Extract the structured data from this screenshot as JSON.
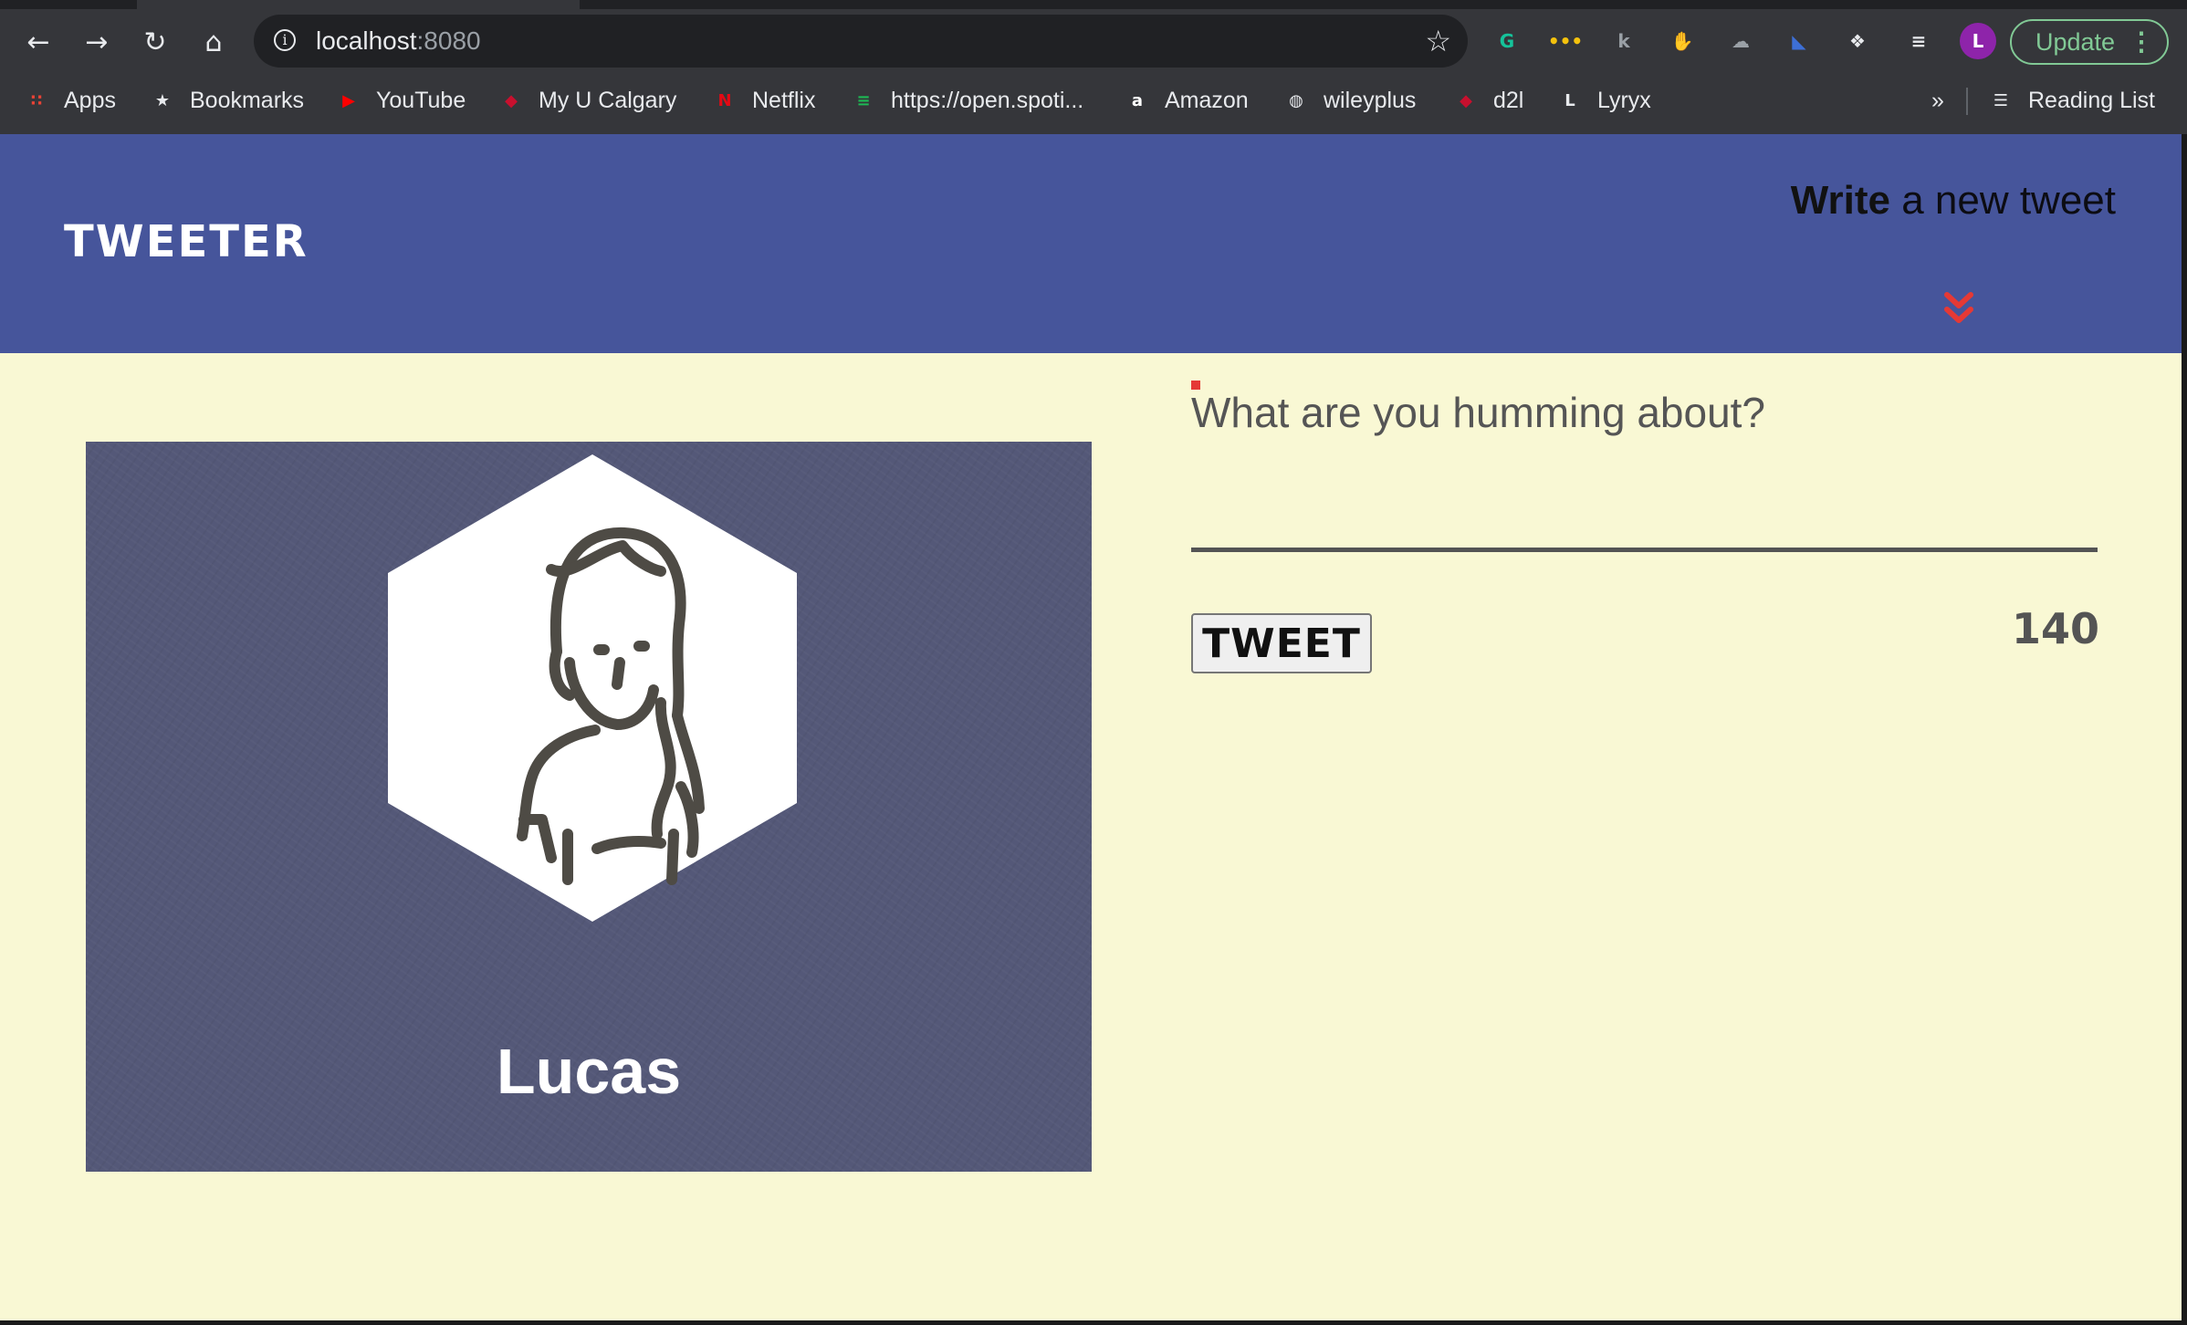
{
  "browser": {
    "address": {
      "host": "localhost",
      "port": ":8080"
    },
    "extensions": [
      {
        "name": "grammarly-icon",
        "glyph": "G",
        "color": "#15c39a"
      },
      {
        "name": "extension-yellow-icon",
        "glyph": "•••",
        "color": "#f4c20d"
      },
      {
        "name": "extension-k-icon",
        "glyph": "k",
        "color": "#9aa0a6"
      },
      {
        "name": "stop-hand-icon",
        "glyph": "✋",
        "color": "#e53935"
      },
      {
        "name": "extension-cloud-icon",
        "glyph": "☁",
        "color": "#9aa0a6"
      },
      {
        "name": "extension-shield-icon",
        "glyph": "◣",
        "color": "#3d6fd6"
      },
      {
        "name": "puzzle-icon",
        "glyph": "❖",
        "color": "#e8eaed"
      },
      {
        "name": "media-queue-icon",
        "glyph": "≡",
        "color": "#e8eaed"
      }
    ],
    "profile_initial": "L",
    "update_label": "Update",
    "bookmarks": [
      {
        "label": "Apps",
        "icon": "apps-grid-icon",
        "icon_color": "#ea4335",
        "glyph": "∷"
      },
      {
        "label": "Bookmarks",
        "icon": "star-icon",
        "icon_color": "#e8eaed",
        "glyph": "★"
      },
      {
        "label": "YouTube",
        "icon": "youtube-icon",
        "icon_color": "#ff0000",
        "glyph": "▶"
      },
      {
        "label": "My U Calgary",
        "icon": "ucalgary-crest-icon",
        "icon_color": "#c8102e",
        "glyph": "◆"
      },
      {
        "label": "Netflix",
        "icon": "netflix-icon",
        "icon_color": "#e50914",
        "glyph": "N"
      },
      {
        "label": "https://open.spoti...",
        "icon": "spotify-icon",
        "icon_color": "#1db954",
        "glyph": "≡"
      },
      {
        "label": "Amazon",
        "icon": "amazon-icon",
        "icon_color": "#ffffff",
        "glyph": "a"
      },
      {
        "label": "wileyplus",
        "icon": "globe-icon",
        "icon_color": "#e8eaed",
        "glyph": "◍"
      },
      {
        "label": "d2l",
        "icon": "d2l-crest-icon",
        "icon_color": "#c8102e",
        "glyph": "◆"
      },
      {
        "label": "Lyryx",
        "icon": "lyryx-icon",
        "icon_color": "#e8eaed",
        "glyph": "L"
      }
    ],
    "overflow_label": "»",
    "reading_list_label": "Reading List"
  },
  "header": {
    "logo": "Tweeter",
    "compose_toggle_bold": "Write",
    "compose_toggle_rest": " a new tweet",
    "accent_color": "#e53935",
    "background_color": "#46559b"
  },
  "profile": {
    "name": "Lucas",
    "card_color": "#545878"
  },
  "compose": {
    "placeholder": "What are you humming about?",
    "value": "",
    "button_label": "TWEET",
    "counter": "140"
  }
}
